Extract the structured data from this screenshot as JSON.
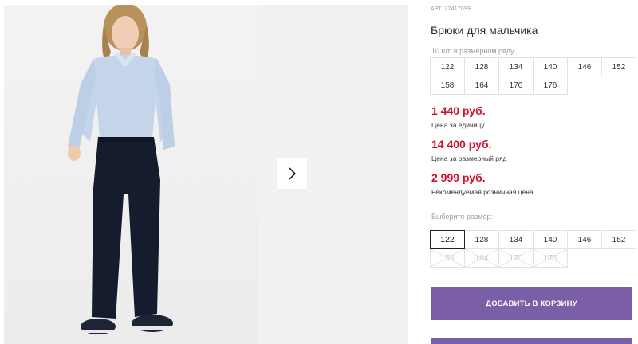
{
  "product": {
    "sku": "АРТ. 22417099",
    "title": "Брюки для мальчика"
  },
  "pack": {
    "label": "10 шт. в размерном ряду",
    "sizes": [
      "122",
      "128",
      "134",
      "140",
      "146",
      "152",
      "158",
      "164",
      "170",
      "176"
    ]
  },
  "prices": {
    "unit": {
      "value": "1 440 руб.",
      "note": "Цена за единицу"
    },
    "pack": {
      "value": "14 400 руб.",
      "note": "Цена за размерный ряд"
    },
    "retail": {
      "value": "2 999 руб.",
      "note": "Рекомендуемая розничная цена"
    }
  },
  "size_select": {
    "label": "Выберите размер:",
    "selected": "122",
    "sizes": [
      {
        "label": "122",
        "available": true
      },
      {
        "label": "128",
        "available": true
      },
      {
        "label": "134",
        "available": true
      },
      {
        "label": "140",
        "available": true
      },
      {
        "label": "146",
        "available": true
      },
      {
        "label": "152",
        "available": true
      },
      {
        "label": "158",
        "available": false
      },
      {
        "label": "164",
        "available": false
      },
      {
        "label": "170",
        "available": false
      },
      {
        "label": "176",
        "available": false
      }
    ]
  },
  "actions": {
    "add_to_cart": "ДОБАВИТЬ В КОРЗИНУ"
  },
  "colors": {
    "price": "#d0112b",
    "button": "#7a5fa6"
  },
  "icons": {
    "gallery_next": "chevron-right-icon"
  }
}
